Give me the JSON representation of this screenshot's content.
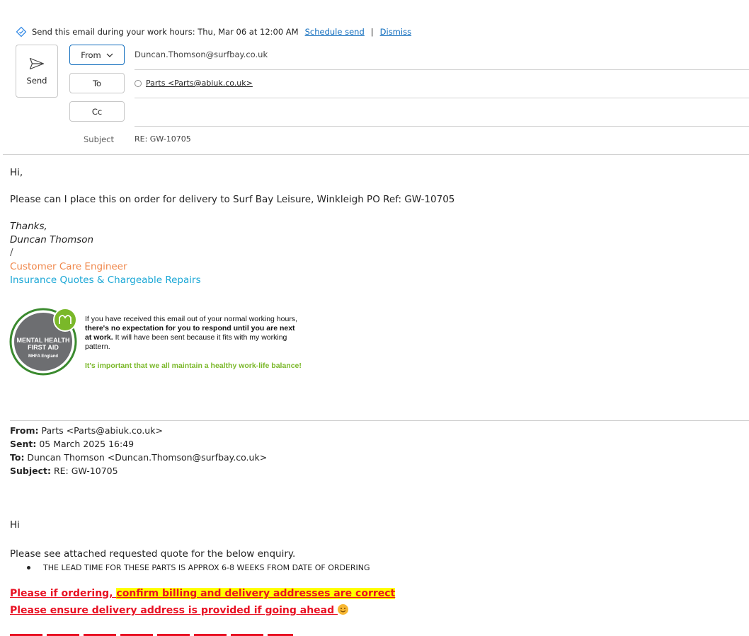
{
  "banner": {
    "text": "Send this email during your work hours: Thu, Mar 06 at 12:00 AM",
    "schedule_label": "Schedule send",
    "separator": "|",
    "dismiss_label": "Dismiss"
  },
  "compose": {
    "send_label": "Send",
    "from_label": "From",
    "from_value": "Duncan.Thomson@surfbay.co.uk",
    "to_label": "To",
    "to_recipient": "Parts <Parts@abiuk.co.uk>",
    "cc_label": "Cc",
    "subject_label": "Subject",
    "subject_value": "RE: GW-10705"
  },
  "body": {
    "greeting": "Hi,",
    "line1": "Please can I place this on order for delivery to Surf Bay Leisure, Winkleigh PO Ref: GW-10705",
    "thanks": "Thanks,",
    "name": "Duncan Thomson",
    "slash": "/",
    "title": "Customer Care Engineer",
    "dept": "Insurance Quotes & Chargeable Repairs"
  },
  "signature": {
    "badge_line1": "MENTAL HEALTH",
    "badge_line2": "FIRST AID",
    "badge_line3": "MHFA England",
    "text_a": "If you have received this email out of your normal working hours, ",
    "text_b": "there's no expectation for you to respond until you are next at work.",
    "text_c": " It will have been sent because it fits with my working pattern.",
    "green": "It's important that we all maintain a healthy work-life balance!",
    "colors": {
      "green": "#7ab829",
      "dark_green": "#3a8a2e",
      "grey": "#6d6e71"
    }
  },
  "quoted": {
    "from_label": "From:",
    "from_value": " Parts <Parts@abiuk.co.uk>",
    "sent_label": "Sent:",
    "sent_value": " 05 March 2025 16:49",
    "to_label": "To:",
    "to_value": " Duncan Thomson <Duncan.Thomson@surfbay.co.uk>",
    "subject_label": "Subject:",
    "subject_value": " RE: GW-10705",
    "greeting": "Hi",
    "line1": "Please see attached requested quote for the below enquiry.",
    "bullet": "THE LEAD TIME FOR THESE PARTS IS APPROX 6-8 WEEKS FROM DATE OF ORDERING",
    "red1_a": "Please if ordering, ",
    "red1_b": "confirm billing and delivery addresses are correct",
    "red2": "Please ensure delivery address is provided if going ahead "
  },
  "colors": {
    "accent": "#0f6cbd",
    "red": "#e81123",
    "highlight": "#ffff00",
    "orange": "#f0884c",
    "cyan": "#1aa7d6"
  }
}
